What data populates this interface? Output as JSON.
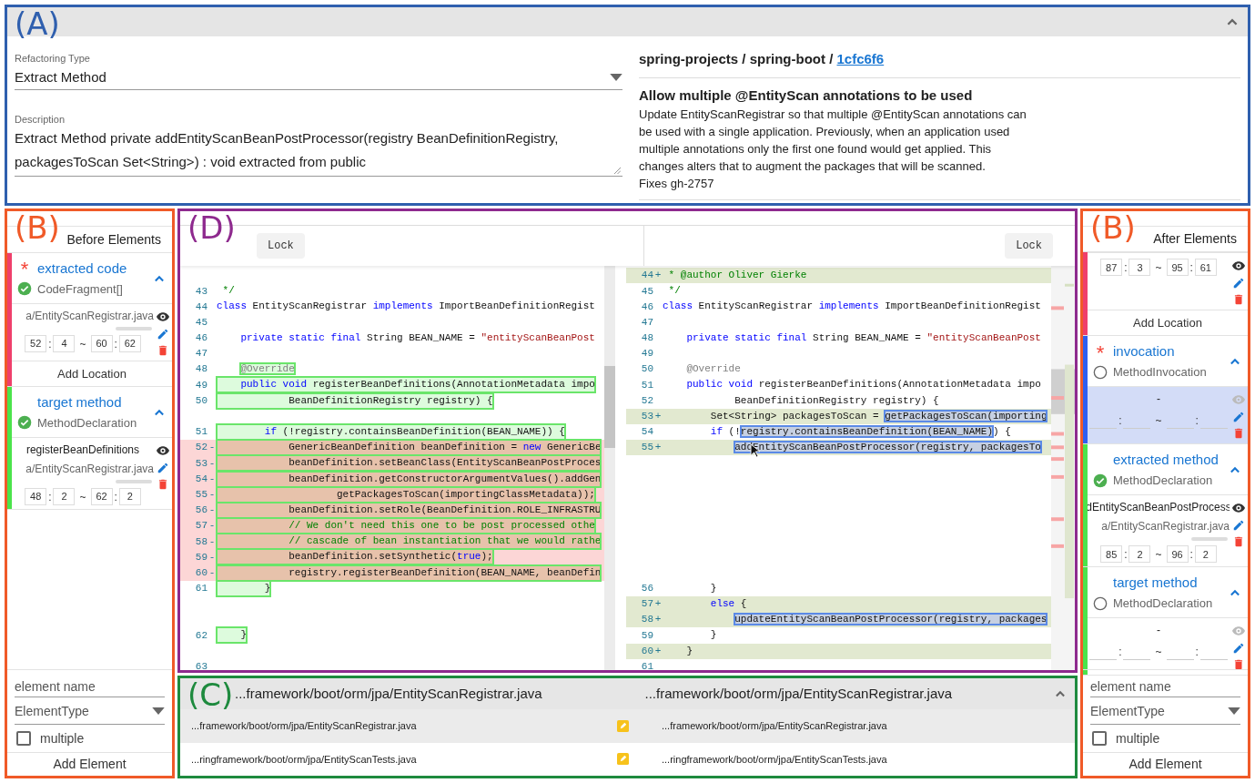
{
  "refactoring": {
    "frame": {
      "label": "(A)",
      "color": "#2f5fae"
    },
    "type_field": {
      "label": "Refactoring Type",
      "value": "Extract Method"
    },
    "description_field": {
      "label": "Description",
      "value": "Extract Method private addEntityScanBeanPostProcessor(registry BeanDefinitionRegistry, packagesToScan Set<String>) : void extracted from public"
    },
    "commit": {
      "repo": "spring-projects / spring-boot / ",
      "hash": "1cfc6f6",
      "title": "Allow multiple @EntityScan annotations to be used",
      "message": "Update EntityScanRegistrar so that multiple @EntityScan annotations can\nbe used with a single application. Previously, when an application used\nmultiple annotations only the first one found would get applied. This\nchanges alters that to augment the packages that will be scanned.\nFixes gh-2757"
    }
  },
  "before_elements": {
    "frame": {
      "label": "(B)",
      "color": "#f05a28"
    },
    "title": "Before Elements",
    "elements": [
      {
        "required_mark": "*",
        "name": "extracted code",
        "type": "CodeFragment[]",
        "done": true,
        "color": "#ef3f6b",
        "expanded": true,
        "selected": false,
        "locations": [
          {
            "file": "a/EntityScanRegistrar.java",
            "start_line": "52",
            "colon_1": ":",
            "start_col": "4",
            "tilde": "~",
            "end_line": "60",
            "colon_2": ":",
            "end_col": "62"
          }
        ],
        "add_location": "Add Location"
      },
      {
        "name": "target method",
        "type": "MethodDeclaration",
        "done": true,
        "color": "#4be34b",
        "expanded": true,
        "selected": false,
        "locations": [
          {
            "label": "registerBeanDefinitions",
            "file": "a/EntityScanRegistrar.java",
            "start_line": "48",
            "colon_1": ":",
            "start_col": "2",
            "tilde": "~",
            "end_line": "62",
            "colon_2": ":",
            "end_col": "2"
          }
        ]
      }
    ],
    "form": {
      "name_placeholder": "element name",
      "type_placeholder": "ElementType",
      "multiple": {
        "label": "multiple",
        "checked": false
      },
      "add_button": "Add Element"
    }
  },
  "diff": {
    "frame": {
      "label": "(D)",
      "color": "#8e2a8e"
    },
    "editors": [
      {
        "kind": "before",
        "lock": "Lock",
        "lines": [
          {
            "kind": "filler"
          },
          {
            "kind": "unchanged",
            "num": "43",
            "marked": false,
            "tokens": [
              {
                "text": " */",
                "kind": "comment"
              }
            ]
          },
          {
            "kind": "unchanged",
            "num": "44",
            "marked": false,
            "tokens": [
              {
                "text": "class",
                "kind": "keyword"
              },
              {
                "text": " EntityScanRegistrar ",
                "kind": "plain"
              },
              {
                "text": "implements",
                "kind": "keyword"
              },
              {
                "text": " ImportBeanDefinitionRegist",
                "kind": "plain"
              }
            ]
          },
          {
            "kind": "unchanged",
            "num": "45",
            "marked": false
          },
          {
            "kind": "unchanged",
            "num": "46",
            "marked": false,
            "tokens": [
              {
                "text": "    private static final",
                "kind": "keyword"
              },
              {
                "text": " String BEAN_NAME = ",
                "kind": "plain"
              },
              {
                "text": "\"entityScanBeanPost",
                "kind": "string"
              }
            ]
          },
          {
            "kind": "unchanged",
            "num": "47",
            "marked": false
          },
          {
            "kind": "unchanged",
            "num": "48",
            "marked": false,
            "tokens": [
              {
                "text": "    @Override",
                "kind": "annotation",
                "marked": true
              }
            ]
          },
          {
            "kind": "unchanged",
            "num": "49",
            "marked": true,
            "tokens": [
              {
                "text": "    public void",
                "kind": "keyword"
              },
              {
                "text": " registerBeanDefinitions(AnnotationMetadata impo",
                "kind": "plain"
              }
            ]
          },
          {
            "kind": "unchanged",
            "num": "50",
            "marked": true,
            "tokens": [
              {
                "text": "            BeanDefinitionRegistry registry) {",
                "kind": "plain"
              }
            ]
          },
          {
            "kind": "filler"
          },
          {
            "kind": "unchanged",
            "num": "51",
            "marked": true,
            "tokens": [
              {
                "text": "        if",
                "kind": "keyword"
              },
              {
                "text": " (!registry.containsBeanDefinition(BEAN_NAME)) {",
                "kind": "plain"
              }
            ]
          },
          {
            "kind": "removed",
            "num": "52",
            "sign": "-",
            "marked": true,
            "tokens": [
              {
                "text": "            GenericBeanDefinition beanDefinition = ",
                "kind": "plain"
              },
              {
                "text": "new",
                "kind": "keyword"
              },
              {
                "text": " GenericBe",
                "kind": "plain"
              }
            ]
          },
          {
            "kind": "removed",
            "num": "53",
            "sign": "-",
            "marked": true,
            "tokens": [
              {
                "text": "            beanDefinition.setBeanClass(EntityScanBeanPostProces",
                "kind": "plain"
              }
            ]
          },
          {
            "kind": "removed",
            "num": "54",
            "sign": "-",
            "marked": true,
            "tokens": [
              {
                "text": "            beanDefinition.getConstructorArgumentValues().addGen",
                "kind": "plain"
              }
            ]
          },
          {
            "kind": "removed",
            "num": "55",
            "sign": "-",
            "marked": true,
            "tokens": [
              {
                "text": "                    getPackagesToScan(importingClassMetadata));",
                "kind": "plain"
              }
            ]
          },
          {
            "kind": "removed",
            "num": "56",
            "sign": "-",
            "marked": true,
            "tokens": [
              {
                "text": "            beanDefinition.setRole(BeanDefinition.ROLE_INFRASTRU",
                "kind": "plain"
              }
            ]
          },
          {
            "kind": "removed",
            "num": "57",
            "sign": "-",
            "marked": true,
            "tokens": [
              {
                "text": "            // We don't need this one to be post processed othe",
                "kind": "comment"
              }
            ]
          },
          {
            "kind": "removed",
            "num": "58",
            "sign": "-",
            "marked": true,
            "tokens": [
              {
                "text": "            // cascade of bean instantiation that we would rathe",
                "kind": "comment"
              }
            ]
          },
          {
            "kind": "removed",
            "num": "59",
            "sign": "-",
            "marked": true,
            "tokens": [
              {
                "text": "            beanDefinition.setSynthetic(",
                "kind": "plain"
              },
              {
                "text": "true",
                "kind": "keyword"
              },
              {
                "text": ");",
                "kind": "plain"
              }
            ]
          },
          {
            "kind": "removed",
            "num": "60",
            "sign": "-",
            "marked": true,
            "tokens": [
              {
                "text": "            registry.registerBeanDefinition(BEAN_NAME, beanDefin",
                "kind": "plain"
              }
            ]
          },
          {
            "kind": "unchanged",
            "num": "61",
            "marked": true,
            "tokens": [
              {
                "text": "        }",
                "kind": "plain"
              }
            ]
          },
          {
            "kind": "filler"
          },
          {
            "kind": "filler"
          },
          {
            "kind": "unchanged",
            "num": "62",
            "marked": true,
            "tokens": [
              {
                "text": "    }",
                "kind": "plain"
              }
            ]
          },
          {
            "kind": "filler"
          },
          {
            "kind": "unchanged",
            "num": "63",
            "marked": false
          }
        ]
      },
      {
        "kind": "after",
        "lock": "Lock",
        "lines": [
          {
            "kind": "added",
            "num": "44",
            "sign": "+",
            "marked": false,
            "tokens": [
              {
                "text": " * @author Oliver Gierke",
                "kind": "comment"
              }
            ]
          },
          {
            "kind": "unchanged",
            "num": "45",
            "marked": false,
            "tokens": [
              {
                "text": " */",
                "kind": "comment"
              }
            ]
          },
          {
            "kind": "unchanged",
            "num": "46",
            "marked": false,
            "tokens": [
              {
                "text": "class",
                "kind": "keyword"
              },
              {
                "text": " EntityScanRegistrar ",
                "kind": "plain"
              },
              {
                "text": "implements",
                "kind": "keyword"
              },
              {
                "text": " ImportBeanDefinitionRegist",
                "kind": "plain"
              }
            ]
          },
          {
            "kind": "unchanged",
            "num": "47",
            "marked": false
          },
          {
            "kind": "unchanged",
            "num": "48",
            "marked": false,
            "tokens": [
              {
                "text": "    private static final",
                "kind": "keyword"
              },
              {
                "text": " String BEAN_NAME = ",
                "kind": "plain"
              },
              {
                "text": "\"entityScanBeanPost",
                "kind": "string"
              }
            ]
          },
          {
            "kind": "unchanged",
            "num": "49",
            "marked": false
          },
          {
            "kind": "unchanged",
            "num": "50",
            "marked": false,
            "tokens": [
              {
                "text": "    @Override",
                "kind": "annotation"
              }
            ]
          },
          {
            "kind": "unchanged",
            "num": "51",
            "marked": false,
            "tokens": [
              {
                "text": "    public void",
                "kind": "keyword"
              },
              {
                "text": " registerBeanDefinitions(AnnotationMetadata impo",
                "kind": "plain"
              }
            ]
          },
          {
            "kind": "unchanged",
            "num": "52",
            "marked": false,
            "tokens": [
              {
                "text": "            BeanDefinitionRegistry registry) {",
                "kind": "plain"
              }
            ]
          },
          {
            "kind": "added",
            "num": "53",
            "sign": "+",
            "marked": false,
            "tokens": [
              {
                "text": "        Set<String> packagesToScan = ",
                "kind": "plain"
              },
              {
                "text": "getPackagesToScan(importing",
                "kind": "plain",
                "marked": true
              }
            ]
          },
          {
            "kind": "unchanged",
            "num": "54",
            "marked": false,
            "tokens": [
              {
                "text": "        if",
                "kind": "keyword"
              },
              {
                "text": " (!",
                "kind": "plain"
              },
              {
                "text": "registry.containsBeanDefinition(BEAN_NAME)",
                "kind": "plain",
                "marked": true
              },
              {
                "text": ") {",
                "kind": "plain"
              }
            ]
          },
          {
            "kind": "added",
            "num": "55",
            "sign": "+",
            "marked": false,
            "tokens": [
              {
                "text": "            addEntityScanBeanPostProcessor(registry, packagesTo",
                "kind": "plain",
                "marked": true
              }
            ]
          },
          {
            "kind": "filler"
          },
          {
            "kind": "filler"
          },
          {
            "kind": "filler"
          },
          {
            "kind": "filler"
          },
          {
            "kind": "filler"
          },
          {
            "kind": "filler"
          },
          {
            "kind": "filler"
          },
          {
            "kind": "filler"
          },
          {
            "kind": "unchanged",
            "num": "56",
            "marked": false,
            "tokens": [
              {
                "text": "        }",
                "kind": "plain"
              }
            ]
          },
          {
            "kind": "added",
            "num": "57",
            "sign": "+",
            "marked": false,
            "tokens": [
              {
                "text": "        else",
                "kind": "keyword"
              },
              {
                "text": " {",
                "kind": "plain"
              }
            ]
          },
          {
            "kind": "added",
            "num": "58",
            "sign": "+",
            "marked": false,
            "tokens": [
              {
                "text": "            updateEntityScanBeanPostProcessor(registry, packages",
                "kind": "plain",
                "marked": true
              }
            ]
          },
          {
            "kind": "unchanged",
            "num": "59",
            "marked": false,
            "tokens": [
              {
                "text": "        }",
                "kind": "plain"
              }
            ]
          },
          {
            "kind": "added",
            "num": "60",
            "sign": "+",
            "marked": false,
            "tokens": [
              {
                "text": "    }",
                "kind": "plain"
              }
            ]
          },
          {
            "kind": "unchanged",
            "num": "61",
            "marked": false
          }
        ]
      }
    ]
  },
  "files": {
    "frame": {
      "label": "(C)",
      "color": "#1e8a3e"
    },
    "header": [
      "...framework/boot/orm/jpa/EntityScanRegistrar.java",
      "...framework/boot/orm/jpa/EntityScanRegistrar.java"
    ],
    "expanded": true,
    "rows": [
      {
        "before": "...framework/boot/orm/jpa/EntityScanRegistrar.java",
        "after": "...framework/boot/orm/jpa/EntityScanRegistrar.java",
        "selected": true
      },
      {
        "before": "...ringframework/boot/orm/jpa/EntityScanTests.java",
        "after": "...ringframework/boot/orm/jpa/EntityScanTests.java",
        "selected": false
      }
    ]
  },
  "after_elements": {
    "frame": {
      "label": "(B)",
      "color": "#f05a28"
    },
    "title": "After Elements",
    "elements": [
      {
        "color": "#ef3f6b",
        "selected": false,
        "locations": [
          {
            "start_line": "87",
            "colon_1": ":",
            "start_col": "3",
            "tilde": "~",
            "end_line": "95",
            "colon_2": ":",
            "end_col": "61"
          }
        ],
        "add_location": "Add Location"
      },
      {
        "required_mark": "*",
        "name": "invocation",
        "type": "MethodInvocation",
        "done": false,
        "color": "#2f5ff0",
        "expanded": true,
        "selected": true,
        "locations": [
          {
            "label": "-",
            "colon_1": ":",
            "tilde": "~",
            "colon_2": ":"
          }
        ]
      },
      {
        "name": "extracted method",
        "type": "MethodDeclaration",
        "done": true,
        "color": "#4be34b",
        "expanded": true,
        "selected": false,
        "locations": [
          {
            "label": "dEntityScanBeanPostProcess",
            "file": "a/EntityScanRegistrar.java",
            "start_line": "85",
            "colon_1": ":",
            "start_col": "2",
            "tilde": "~",
            "end_line": "96",
            "colon_2": ":",
            "end_col": "2"
          }
        ]
      },
      {
        "name": "target method",
        "type": "MethodDeclaration",
        "done": false,
        "color": "#4be34b",
        "expanded": true,
        "selected": false,
        "locations": [
          {
            "label": "-",
            "colon_1": ":",
            "tilde": "~",
            "colon_2": ":"
          }
        ]
      }
    ],
    "form": {
      "name_placeholder": "element name",
      "type_placeholder": "ElementType",
      "multiple": {
        "label": "multiple",
        "checked": false
      },
      "add_button": "Add Element"
    }
  }
}
